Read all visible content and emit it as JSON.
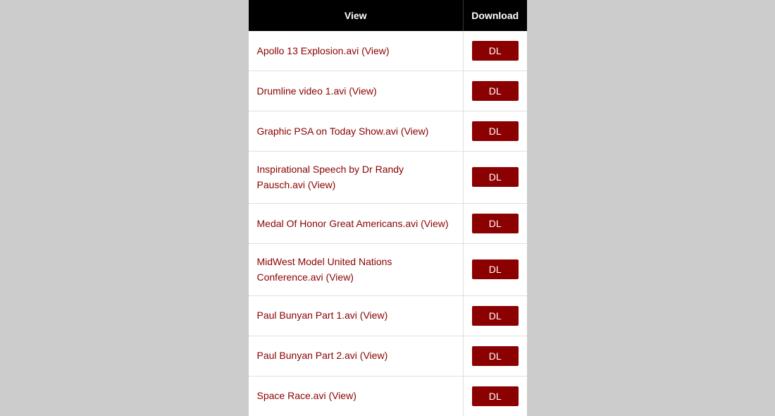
{
  "headers": {
    "view": "View",
    "download": "Download"
  },
  "download_label": "DL",
  "rows": [
    {
      "label": "Apollo 13 Explosion.avi (View)"
    },
    {
      "label": "Drumline video 1.avi (View)"
    },
    {
      "label": "Graphic PSA on Today Show.avi (View)"
    },
    {
      "label": "Inspirational Speech by Dr Randy Pausch.avi (View)"
    },
    {
      "label": "Medal Of Honor Great Americans.avi (View)"
    },
    {
      "label": "MidWest Model United Nations Conference.avi (View)"
    },
    {
      "label": "Paul Bunyan Part 1.avi (View)"
    },
    {
      "label": "Paul Bunyan Part 2.avi (View)"
    },
    {
      "label": "Space Race.avi (View)"
    }
  ]
}
